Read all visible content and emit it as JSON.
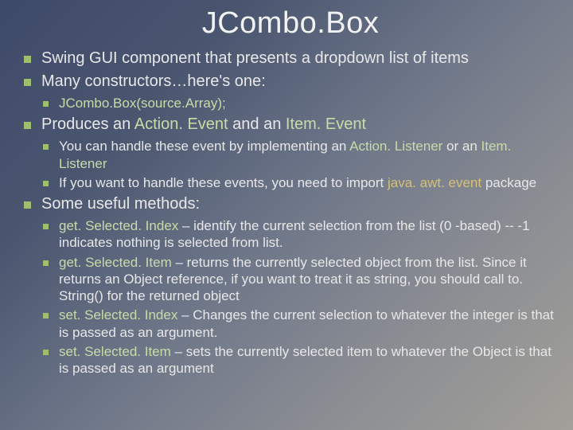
{
  "title": "JCombo.Box",
  "b1": "Swing GUI component that presents a dropdown list of items",
  "b2": "Many constructors…here's one:",
  "b2a": "JCombo.Box(source.Array);",
  "b3_a": "Produces an ",
  "b3_b": "Action. Event",
  "b3_c": " and an ",
  "b3_d": "Item. Event",
  "b3i_a": "You can handle these event by implementing an ",
  "b3i_b": "Action. Listener",
  "b3i_c": " or an ",
  "b3i_d": "Item. Listener",
  "b3ii_a": "If you want to handle these events, you need to import ",
  "b3ii_b": "java. awt. event",
  "b3ii_c": " package",
  "b4": "Some useful methods:",
  "m1n": "get. Selected. Index",
  "m1t": " – identify the current selection from the list (0 -based) -- -1 indicates nothing is selected from list.",
  "m2n": "get. Selected. Item",
  "m2t": " – returns the currently selected object from the list. Since it returns an Object reference, if you want to treat it as string, you should call to. String() for the returned object",
  "m3n": " set. Selected. Index",
  "m3t": " – Changes the current selection to whatever the integer is that is passed as an argument.",
  "m4n": "set. Selected. Item",
  "m4t": " – sets the currently selected item to whatever the Object is that is passed as an argument"
}
